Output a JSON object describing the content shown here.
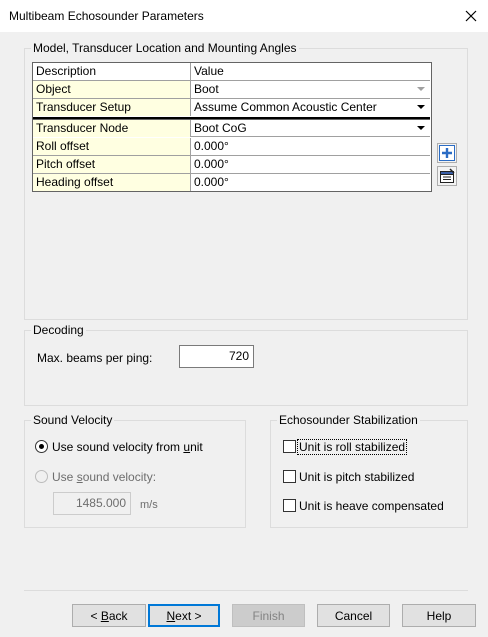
{
  "window": {
    "title": "Multibeam Echosounder Parameters"
  },
  "model_group": {
    "legend": "Model, Transducer Location and Mounting Angles",
    "header": {
      "col1": "Description",
      "col2": "Value"
    },
    "rows_top": [
      {
        "label": "Object",
        "value": "Boot"
      },
      {
        "label": "Transducer Setup",
        "value": "Assume Common Acoustic Center"
      }
    ],
    "rows_bottom": [
      {
        "label": "Transducer Node",
        "value": "Boot CoG"
      },
      {
        "label": "Roll offset",
        "value": "0.000°"
      },
      {
        "label": "Pitch offset",
        "value": "0.000°"
      },
      {
        "label": "Heading offset",
        "value": "0.000°"
      }
    ],
    "side_buttons": {
      "add_icon": "plus-icon",
      "edit_icon": "properties-icon"
    }
  },
  "decoding": {
    "legend": "Decoding",
    "max_beams_label": "Max.  beams per ping:",
    "max_beams_value": "720"
  },
  "sound_velocity": {
    "legend": "Sound Velocity",
    "option_unit": {
      "prefix": "Use sound velocity from ",
      "underlined": "u",
      "suffix": "nit",
      "selected": true
    },
    "option_manual": {
      "prefix": "Use ",
      "underlined": "s",
      "suffix": "ound velocity:",
      "selected": false
    },
    "velocity_value": "1485.000",
    "velocity_unit": "m/s"
  },
  "stabilization": {
    "legend": "Echosounder Stabilization",
    "roll": {
      "label": "Unit is roll stabilized",
      "checked": false
    },
    "pitch": {
      "label": "Unit is pitch stabilized",
      "checked": false
    },
    "heave": {
      "label": "Unit is heave compensated",
      "checked": false
    }
  },
  "buttons": {
    "back": {
      "prefix": "< ",
      "underlined": "B",
      "suffix": "ack"
    },
    "next": {
      "underlined": "N",
      "suffix": "ext >"
    },
    "finish": "Finish",
    "cancel": "Cancel",
    "help": "Help"
  }
}
